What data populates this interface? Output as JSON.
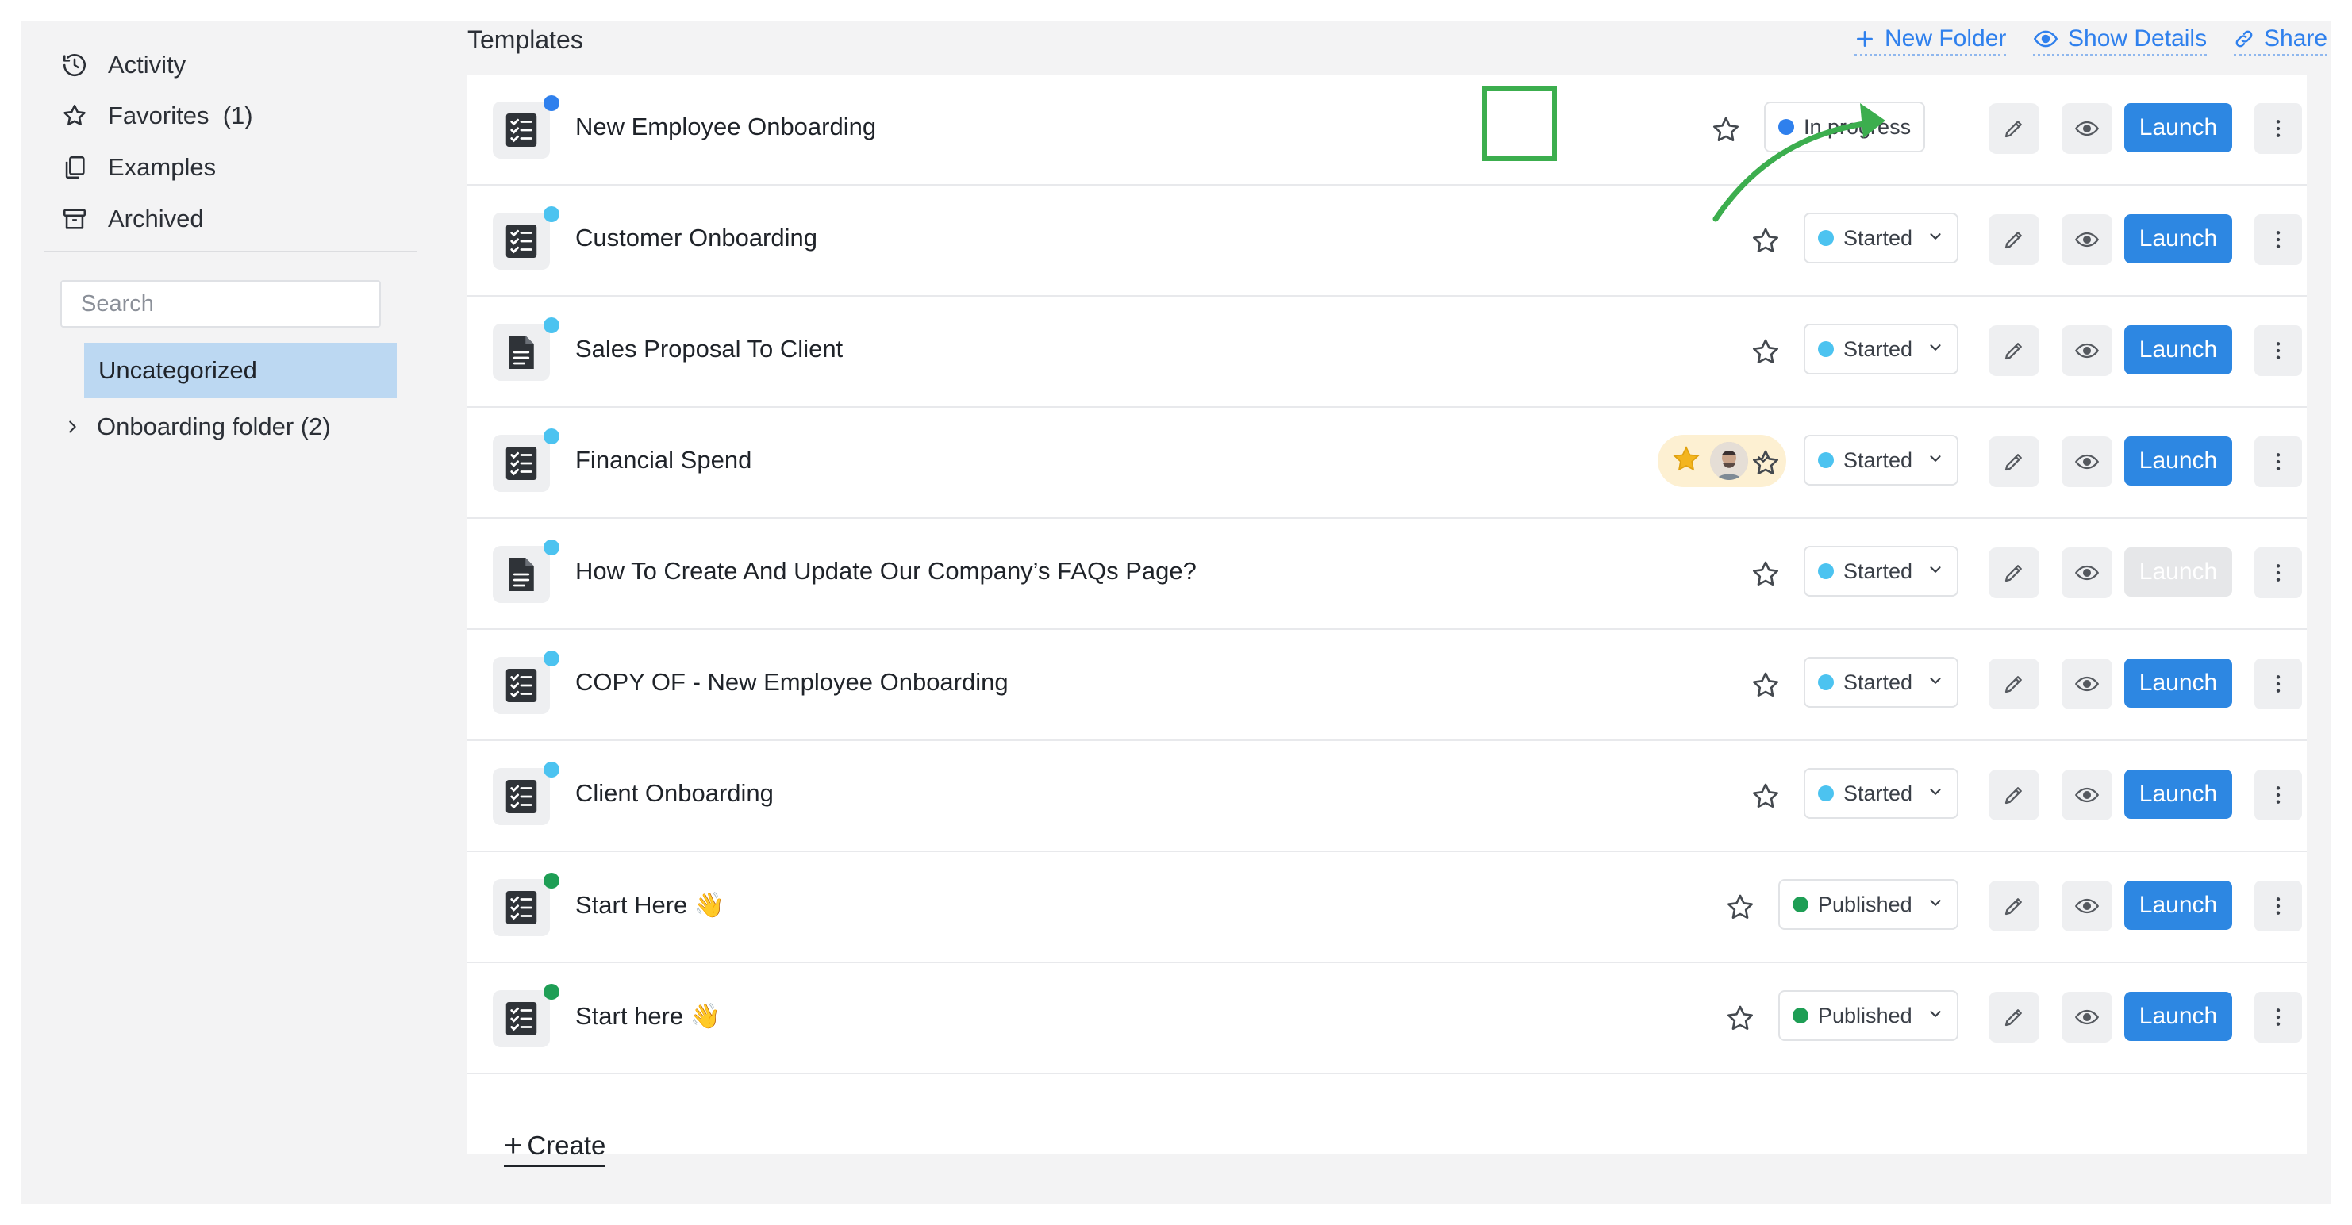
{
  "sidebar": {
    "nav": [
      {
        "label": "Activity",
        "icon": "history-icon"
      },
      {
        "label": "Favorites  (1)",
        "icon": "star-outline-icon"
      },
      {
        "label": "Examples",
        "icon": "copy-icon"
      },
      {
        "label": "Archived",
        "icon": "archive-icon"
      }
    ],
    "search_placeholder": "Search",
    "folders": {
      "selected": "Uncategorized",
      "onboarding": "Onboarding folder (2)"
    }
  },
  "main": {
    "title": "Templates",
    "actions": {
      "new_folder": "New Folder",
      "show_details": "Show Details",
      "share": "Share"
    },
    "launch_label": "Launch",
    "create_label": "Create",
    "rows": [
      {
        "title": "New Employee Onboarding",
        "status": "In progress",
        "status_color": "#2f80ed",
        "dot_color": "#2f80ed",
        "doc_type": "checklist"
      },
      {
        "title": "Customer Onboarding",
        "status": "Started",
        "status_color": "#4cc3f0",
        "dot_color": "#4cc3f0",
        "doc_type": "checklist"
      },
      {
        "title": "Sales Proposal To Client",
        "status": "Started",
        "status_color": "#4cc3f0",
        "dot_color": "#4cc3f0",
        "doc_type": "document"
      },
      {
        "title": "Financial Spend",
        "status": "Started",
        "status_color": "#4cc3f0",
        "dot_color": "#4cc3f0",
        "doc_type": "checklist",
        "has_assignee": true
      },
      {
        "title": "How To Create And Update Our Company’s FAQs Page?",
        "status": "Started",
        "status_color": "#4cc3f0",
        "dot_color": "#4cc3f0",
        "doc_type": "document",
        "launch_disabled": true
      },
      {
        "title": "COPY OF - New Employee Onboarding",
        "status": "Started",
        "status_color": "#4cc3f0",
        "dot_color": "#4cc3f0",
        "doc_type": "checklist"
      },
      {
        "title": "Client Onboarding",
        "status": "Started",
        "status_color": "#4cc3f0",
        "dot_color": "#4cc3f0",
        "doc_type": "checklist"
      },
      {
        "title": "Start Here 👋",
        "status": "Published",
        "status_color": "#1e9e55",
        "dot_color": "#1e9e55",
        "doc_type": "checklist"
      },
      {
        "title": "Start here 👋",
        "status": "Published",
        "status_color": "#1e9e55",
        "dot_color": "#1e9e55",
        "doc_type": "checklist"
      }
    ]
  },
  "colors": {
    "accent": "#2d87e2",
    "highlight": "#3cae4e",
    "selected_folder": "#bcd8f2"
  }
}
